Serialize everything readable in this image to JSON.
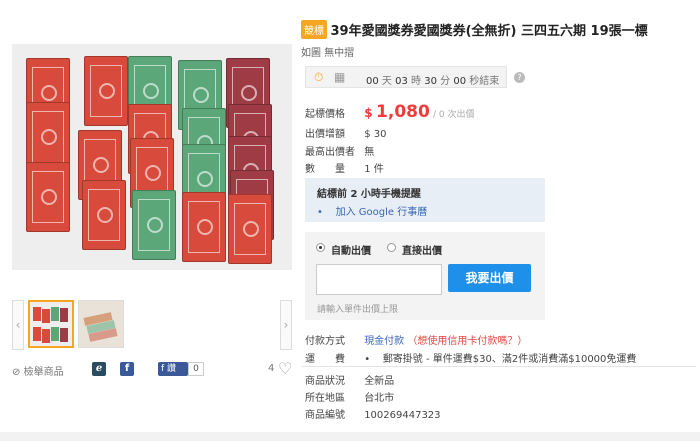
{
  "listing": {
    "badge": "競標",
    "title": "39年愛國獎券愛國獎券(全無折) 三四五六期 19張一標",
    "subtitle": "如圖 無中摺"
  },
  "countdown": {
    "days": "00",
    "days_unit": "天",
    "hours": "03",
    "hours_unit": "時",
    "minutes": "30",
    "minutes_unit": "分",
    "seconds": "00",
    "seconds_unit": "秒結束"
  },
  "details": {
    "start_price_label": "起標價格",
    "currency": "$",
    "price": "1,080",
    "bids": "/ 0 次出價",
    "increment_label": "出價增額",
    "increment_value": "$ 30",
    "top_bidder_label": "最高出價者",
    "top_bidder_value": "無",
    "quantity_label": "數　　量",
    "quantity_value": "1 件"
  },
  "reminder": {
    "heading": "結標前 2 小時手機提醒",
    "gcal_link": "加入 Google 行事曆"
  },
  "bid": {
    "auto_label": "自動出價",
    "direct_label": "直接出價",
    "input_value": "",
    "button_label": "我要出價",
    "hint": "請輸入單件出價上限"
  },
  "payment": {
    "label": "付款方式",
    "link": "現金付款",
    "credit_question": "（想使用信用卡付款嗎？）"
  },
  "shipping": {
    "label": "運　　費",
    "text": "郵寄掛號 - 單件運費$30、滿2件或消費滿$10000免運費"
  },
  "item_info": {
    "condition_label": "商品狀況",
    "condition_value": "全新品",
    "location_label": "所在地區",
    "location_value": "台北市",
    "id_label": "商品編號",
    "id_value": "100269447323"
  },
  "actions": {
    "report": "檢舉商品",
    "fb_like": "讚",
    "like_count": "0",
    "fav_count": "4"
  },
  "icons": {
    "countdown": "stopwatch-icon",
    "calendar": "calendar-icon",
    "help": "question-icon",
    "report": "report-icon",
    "plurk": "plurk-icon",
    "facebook": "facebook-icon",
    "heart": "heart-icon"
  },
  "colors": {
    "price": "#f03b3b",
    "badge": "#f6a623",
    "bid_button": "#1e90ea",
    "link": "#3a66b5"
  }
}
